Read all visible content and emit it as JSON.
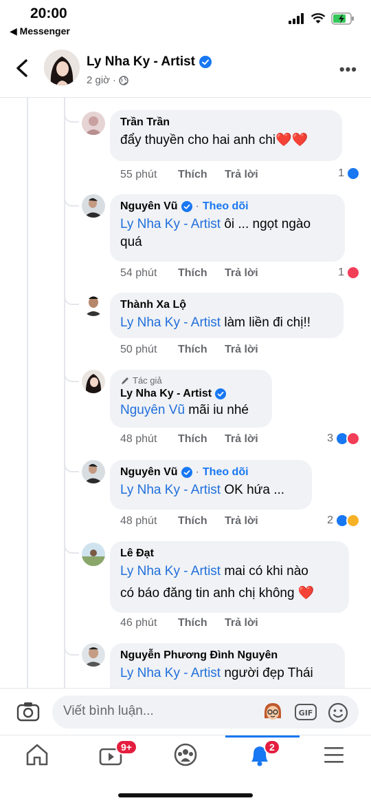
{
  "status_bar": {
    "time": "20:00",
    "back_app": "◀ Messenger"
  },
  "post": {
    "author": "Ly Nha Ky - Artist",
    "time": "2 giờ",
    "dot": "·"
  },
  "comments": [
    {
      "name": "Trần Trần",
      "text": "đẩy thuyền cho hai anh chi❤️❤️",
      "time": "55 phút",
      "like": "Thích",
      "reply": "Trả lời",
      "react_count": "1",
      "reacts": [
        "like"
      ]
    },
    {
      "name": "Nguyên Vũ",
      "follow": "Theo dõi",
      "mention": "Ly Nha Ky - Artist",
      "text": " ôi ... ngọt ngào",
      "text2": "quá",
      "time": "54 phút",
      "like": "Thích",
      "reply": "Trả lời",
      "react_count": "1",
      "reacts": [
        "love"
      ]
    },
    {
      "name": "Thành Xa Lộ",
      "mention": "Ly Nha Ky - Artist",
      "text": " làm liền đi chị!!",
      "time": "50 phút",
      "like": "Thích",
      "reply": "Trả lời"
    },
    {
      "author_tag": "Tác giả",
      "name": "Ly Nha Ky - Artist",
      "mention": "Nguyên Vũ",
      "text": " mãi iu nhé",
      "time": "48 phút",
      "like": "Thích",
      "reply": "Trả lời",
      "react_count": "3",
      "reacts": [
        "like",
        "love"
      ]
    },
    {
      "name": "Nguyên Vũ",
      "follow": "Theo dõi",
      "mention": "Ly Nha Ky - Artist",
      "text": " OK hứa ...",
      "time": "48 phút",
      "like": "Thích",
      "reply": "Trả lời",
      "react_count": "2",
      "reacts": [
        "like",
        "haha"
      ]
    },
    {
      "name": "Lê Đạt",
      "mention": "Ly Nha Ky - Artist",
      "text": "  mai có khi nào",
      "text2": "có báo đăng tin anh chị không ❤️",
      "time": "46 phút",
      "like": "Thích",
      "reply": "Trả lời"
    },
    {
      "name": "Nguyễn Phương Đình Nguyên",
      "mention": "Ly Nha Ky - Artist",
      "text": " người đẹp Thái"
    }
  ],
  "composer": {
    "placeholder": "Viết bình luận...",
    "gif": "GIF"
  },
  "nav": {
    "watch_badge": "9+",
    "notif_badge": "2"
  },
  "colors": {
    "accent": "#1877f2",
    "love": "#f33e58",
    "bubble": "#f0f2f5"
  }
}
